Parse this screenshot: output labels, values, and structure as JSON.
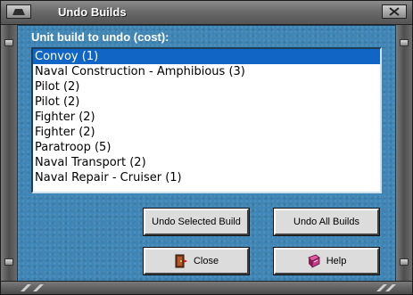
{
  "window": {
    "title": "Undo Builds"
  },
  "panel": {
    "prompt": "Unit build to undo (cost):"
  },
  "list": {
    "items": [
      {
        "label": "Convoy (1)",
        "selected": true
      },
      {
        "label": "Naval Construction - Amphibious (3)",
        "selected": false
      },
      {
        "label": "Pilot (2)",
        "selected": false
      },
      {
        "label": "Pilot (2)",
        "selected": false
      },
      {
        "label": "Fighter (2)",
        "selected": false
      },
      {
        "label": "Fighter (2)",
        "selected": false
      },
      {
        "label": "Paratroop (5)",
        "selected": false
      },
      {
        "label": "Naval Transport (2)",
        "selected": false
      },
      {
        "label": "Naval Repair - Cruiser (1)",
        "selected": false
      }
    ]
  },
  "buttons": {
    "undo_selected": "Undo Selected Build",
    "undo_all": "Undo All Builds",
    "close": "Close",
    "help": "Help"
  },
  "icons": {
    "close": "close-door-icon",
    "help": "help-book-icon",
    "window_left": "window-menu-icon",
    "window_right": "window-close-x-icon"
  },
  "colors": {
    "panel": "#3f86b6",
    "selection": "#1165c4",
    "titlebar": "#6a6a6a"
  }
}
